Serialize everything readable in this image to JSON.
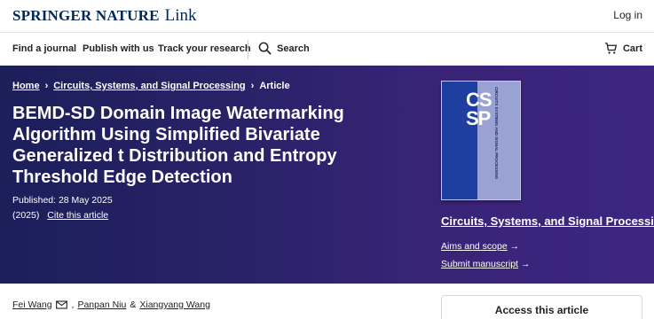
{
  "header": {
    "brand_name": "SPRINGER NATURE",
    "brand_suffix": "Link",
    "login_label": "Log in"
  },
  "nav": {
    "items": [
      "Find a journal",
      "Publish with us",
      "Track your research"
    ],
    "search_label": "Search",
    "cart_label": "Cart"
  },
  "breadcrumb": {
    "items": [
      "Home",
      "Circuits, Systems, and Signal Processing",
      "Article"
    ]
  },
  "article": {
    "title": "BEMD-SD Domain Image Watermarking Algorithm Using Simplified Bivariate Generalized t Distribution and Entropy Threshold Edge Detection",
    "published": "Published: 28 May 2025",
    "year": "(2025)",
    "cite_label": "Cite this article",
    "authors": [
      "Fei Wang",
      "Panpan Niu",
      "Xiangyang Wang"
    ],
    "author_separators": [
      ",",
      "&"
    ]
  },
  "journal": {
    "cover_letters_top": "CS",
    "cover_letters_bottom": "SP",
    "cover_vertical_text": "CIRCUITS SYSTEMS AND SIGNAL PROCESSING",
    "name": "Circuits, Systems, and Signal Processing",
    "aims_label": "Aims and scope",
    "submit_label": "Submit manuscript",
    "arrow": "→"
  },
  "access": {
    "title": "Access this article"
  },
  "colors": {
    "brand": "#00285a",
    "hero_start": "#1b1f5a",
    "hero_end": "#3d2580",
    "cover_blue": "#1e3fa0",
    "cover_lavender": "#9aa2d4"
  },
  "icons": {
    "search": "search-icon",
    "cart": "cart-icon",
    "mail": "mail-icon",
    "chevron": "chevron-right-icon"
  }
}
